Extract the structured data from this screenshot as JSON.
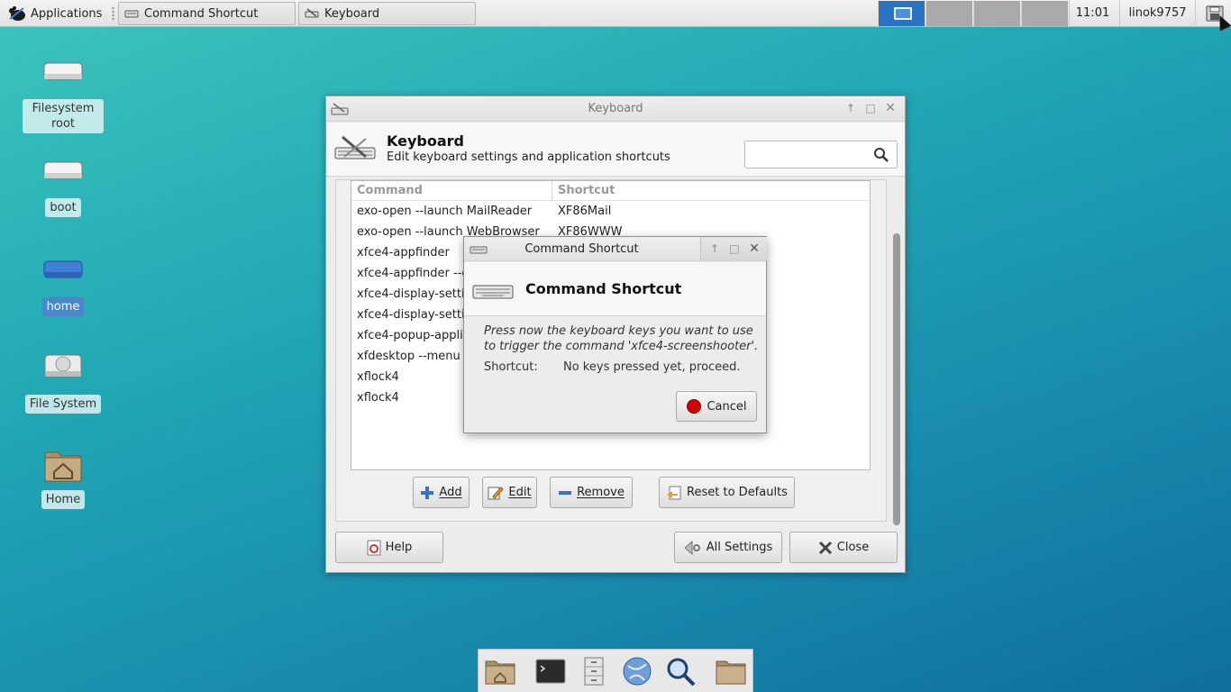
{
  "panel": {
    "applications_label": "Applications",
    "tasks": [
      {
        "label": "Command Shortcut"
      },
      {
        "label": "Keyboard"
      }
    ],
    "clock": "11:01",
    "user": "linok9757"
  },
  "desktop": {
    "icons": [
      {
        "label": "Filesystem root"
      },
      {
        "label": "boot"
      },
      {
        "label": "home"
      },
      {
        "label": "File System"
      },
      {
        "label": "Home"
      }
    ]
  },
  "keyboard_window": {
    "title": "Keyboard",
    "header_title": "Keyboard",
    "header_subtitle": "Edit keyboard settings and application shortcuts",
    "search_placeholder": "",
    "table": {
      "columns": [
        "Command",
        "Shortcut"
      ],
      "rows": [
        {
          "command": "exo-open --launch MailReader",
          "shortcut": "XF86Mail"
        },
        {
          "command": "exo-open --launch WebBrowser",
          "shortcut": "XF86WWW"
        },
        {
          "command": "xfce4-appfinder",
          "shortcut": ""
        },
        {
          "command": "xfce4-appfinder --c",
          "shortcut": ""
        },
        {
          "command": "xfce4-display-setti",
          "shortcut": ""
        },
        {
          "command": "xfce4-display-setti",
          "shortcut": ""
        },
        {
          "command": "xfce4-popup-applic",
          "shortcut": ""
        },
        {
          "command": "xfdesktop --menu",
          "shortcut": ""
        },
        {
          "command": "xflock4",
          "shortcut": ""
        },
        {
          "command": "xflock4",
          "shortcut": ""
        }
      ]
    },
    "buttons": {
      "add": "Add",
      "edit": "Edit",
      "remove": "Remove",
      "reset": "Reset to Defaults",
      "help": "Help",
      "all_settings": "All Settings",
      "close": "Close"
    }
  },
  "shortcut_dialog": {
    "title": "Command Shortcut",
    "header_title": "Command Shortcut",
    "message": "Press now the keyboard keys you want to use to trigger the command 'xfce4-screenshooter'.",
    "shortcut_label": "Shortcut:",
    "shortcut_value": "No keys pressed yet, proceed.",
    "cancel_label": "Cancel"
  },
  "dock": {
    "items": [
      "home-folder-icon",
      "terminal-icon",
      "file-manager-icon",
      "web-browser-icon",
      "app-finder-icon",
      "folder-icon"
    ]
  },
  "colors": {
    "accent": "#2a73c2",
    "cancel_red": "#d40000"
  }
}
